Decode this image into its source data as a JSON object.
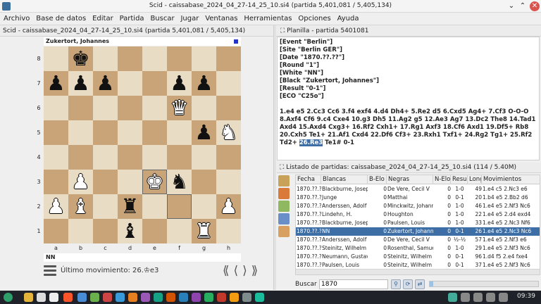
{
  "window": {
    "title": "Scid - caissabase_2024_04_27-14_25_10.si4 (partida 5,401,081 / 5,405,134)"
  },
  "menu": [
    "Archivo",
    "Base de datos",
    "Editar",
    "Partida",
    "Buscar",
    "Jugar",
    "Ventanas",
    "Herramientas",
    "Opciones",
    "Ayuda"
  ],
  "board_panel": {
    "title": "Scid - caissabase_2024_04_27-14_25_10.si4 (partida 5,401,081 / 5,405,134)",
    "top_player": "Zukertort, Johannes",
    "bottom_player": "NN",
    "ranks": [
      "8",
      "7",
      "6",
      "5",
      "4",
      "3",
      "2",
      "1"
    ],
    "files": [
      "a",
      "b",
      "c",
      "d",
      "e",
      "f",
      "g",
      "h"
    ],
    "board": [
      [
        "",
        "bk",
        "",
        "",
        "",
        "",
        "",
        ""
      ],
      [
        "bp",
        "bp",
        "bp",
        "",
        "",
        "bp",
        "bp",
        ""
      ],
      [
        "",
        "",
        "",
        "",
        "",
        "wq",
        "",
        ""
      ],
      [
        "",
        "",
        "",
        "",
        "",
        "",
        "bp",
        "wn"
      ],
      [
        "",
        "",
        "",
        "",
        "",
        "",
        "",
        ""
      ],
      [
        "",
        "wp",
        "",
        "",
        "wk",
        "bn",
        "",
        ""
      ],
      [
        "wp",
        "wb",
        "",
        "br",
        "",
        "",
        "",
        "wp"
      ],
      [
        "",
        "",
        "",
        "bb",
        "",
        "",
        "wr",
        ""
      ]
    ],
    "highlight": [
      "e3",
      "f2"
    ],
    "last_move_label": "Último movimiento: 26.♔e3",
    "nav_buttons": [
      "⟪",
      "⟨",
      "⟩",
      "⟫"
    ]
  },
  "pgn_panel": {
    "title": "Planilla - partida 5401081",
    "tags": [
      "[Event \"Berlin\"]",
      "[Site \"Berlin GER\"]",
      "[Date \"1870.??.??\"]",
      "[Round \"1\"]",
      "[White \"NN\"]",
      "[Black \"Zukertort, Johannes\"]",
      "[Result \"0-1\"]",
      "[ECO \"C25o\"]"
    ],
    "moves_before": "1.e4 e5 2.Cc3 Cc6 3.f4 exf4 4.d4 Dh4+ 5.Re2 d5 6.Cxd5 Ag4+ 7.Cf3 O-O-O 8.Axf4 Cf6 9.c4 Cxe4 10.g3 Dh5 11.Ag2 g5 12.Ae3 Ag7 13.Dc2 The8 14.Tad1 Axd4 15.Axd4 Cxg3+ 16.Rf2 Cxh1+ 17.Rg1 Axf3 18.Cf6 Axd1 19.Df5+ Rb8 20.Cxh5 Te1+ 21.Af1 Cxd4 22.Df6 Cf3+ 23.Rxh1 Txf1+ 24.Rg2 Tg1+ 25.Rf2 Td2+",
    "current_move": "26.Re3",
    "moves_after": "Te1# 0-1"
  },
  "gamelist": {
    "title": "Listado de partidas: caissabase_2024_04_27-14_25_10.si4 (114 / 5.40M)",
    "columns": [
      "Fecha",
      "Blancas",
      "B-Elo",
      "Negras",
      "N-Elo",
      "Resultado",
      "Long",
      "Movimientos"
    ],
    "rows": [
      [
        "1870.??.??",
        "Blackburne, Joseph",
        "0",
        "De Vere, Cecil V",
        "0",
        "1-0",
        "49",
        "1.e4 c5 2.Nc3 e6"
      ],
      [
        "1870.??.??",
        "Junge",
        "0",
        "Matthai",
        "0",
        "0-1",
        "20",
        "1.b4 e5 2.Bb2 d6"
      ],
      [
        "1870.??.??",
        "Anderssen, Adolf",
        "0",
        "Minckwitz, Johannes",
        "0",
        "1-0",
        "46",
        "1.e4 e5 2.Nf3 Nc6"
      ],
      [
        "1870.??.??",
        "Lindehn, H.",
        "0",
        "Houghton",
        "0",
        "1-0",
        "22",
        "1.e4 e5 2.d4 exd4"
      ],
      [
        "1870.??.??",
        "Blackburne, Joseph",
        "0",
        "Paulsen, Louis",
        "0",
        "1-0",
        "33",
        "1.e4 e5 2.Nc3 Nf6"
      ],
      [
        "1870.??.??",
        "NN",
        "0",
        "Zukertort, Johannes",
        "0",
        "0-1",
        "26",
        "1.e4 e5 2.Nc3 Nc6"
      ],
      [
        "1870.??.??",
        "Anderssen, Adolf",
        "0",
        "De Vere, Cecil V",
        "0",
        "½-½",
        "57",
        "1.e4 e5 2.Nf3 e6"
      ],
      [
        "1870.??.??",
        "Steinitz, Wilhelm",
        "0",
        "Rosenthal, Samuel",
        "0",
        "1-0",
        "29",
        "1.e4 e5 2.Nf3 Nc6"
      ],
      [
        "1870.??.??",
        "Neumann, Gustav",
        "0",
        "Steinitz, Wilhelm",
        "0",
        "0-1",
        "96",
        "1.d4 f5 2.e4 fxe4"
      ],
      [
        "1870.??.??",
        "Paulsen, Louis",
        "0",
        "Steinitz, Wilhelm",
        "0",
        "0-1",
        "37",
        "1.e4 e5 2.Nf3 Nc6"
      ]
    ],
    "selected_row": 5,
    "search_label": "Buscar",
    "search_value": "1870",
    "progress": 0.03
  },
  "taskbar": {
    "clock": "09:39"
  },
  "colors": {
    "accent": "#3d6fa6",
    "light_square": "#e8dcc4",
    "dark_square": "#c8a478"
  }
}
